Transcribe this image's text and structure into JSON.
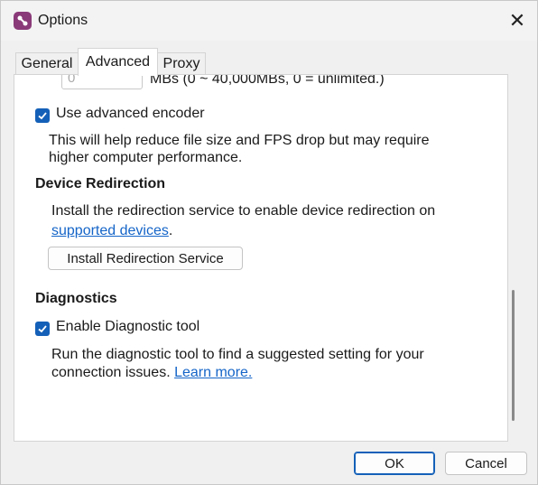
{
  "window": {
    "title": "Options",
    "close_glyph": "✕"
  },
  "tabs": [
    {
      "label": "General"
    },
    {
      "label": "Advanced"
    },
    {
      "label": "Proxy"
    }
  ],
  "advanced": {
    "limit_input_value": "0",
    "limit_hint": "MBs (0 ~ 40,000MBs, 0 = unlimited.)",
    "encoder": {
      "checked": true,
      "label": "Use advanced encoder",
      "desc_line1": "This will help reduce file size and FPS drop but may require",
      "desc_line2": "higher computer performance."
    },
    "redirection": {
      "heading": "Device Redirection",
      "desc_line1": "Install the redirection service to enable device redirection on",
      "link": "supported devices",
      "link_suffix": ".",
      "button": "Install Redirection Service"
    },
    "diagnostics": {
      "heading": "Diagnostics",
      "checked": true,
      "label": "Enable Diagnostic tool",
      "desc_line1": "Run the diagnostic tool to find a suggested setting for your",
      "desc_line2_prefix": "connection issues.",
      "link": "Learn more."
    }
  },
  "footer": {
    "ok": "OK",
    "cancel": "Cancel"
  },
  "colors": {
    "accent": "#1460b8",
    "link": "#1565c8"
  }
}
